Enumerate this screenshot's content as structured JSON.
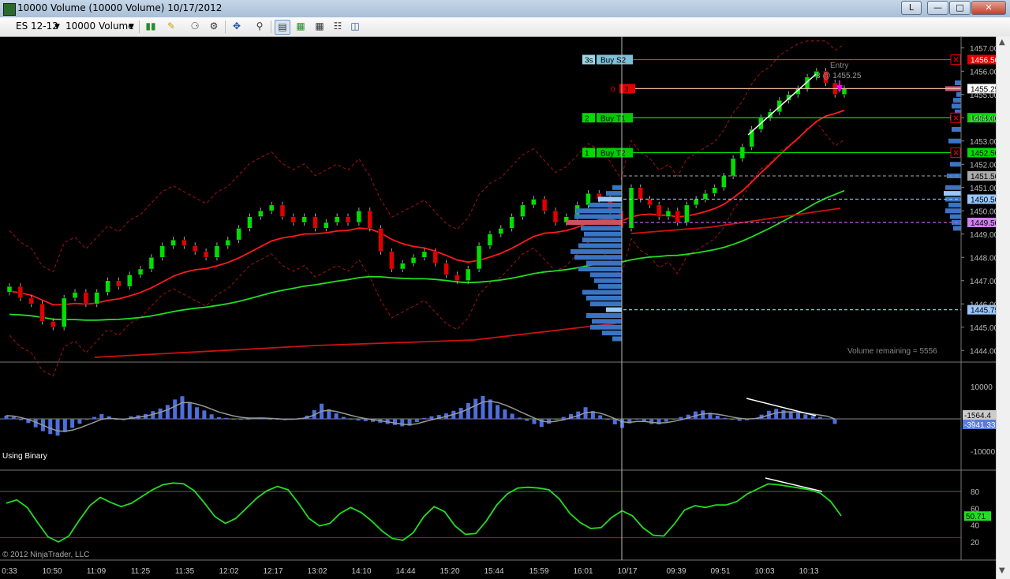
{
  "window": {
    "title": "10000 Volume (10000 Volume)  10/17/2012",
    "language_indicator": "L",
    "controls": [
      "minimize-icon",
      "restore-icon",
      "close-icon"
    ]
  },
  "toolbar": {
    "instrument": "ES 12-12",
    "period": "10000 Volume",
    "icons": [
      "bar-type-icon",
      "draw-pencil-icon",
      "indicator-icon",
      "strategy-icon",
      "crosshair-icon",
      "zoom-icon",
      "chart-trader-icon",
      "data-box-icon",
      "properties-icon",
      "templates-icon"
    ]
  },
  "colors": {
    "up_candle": "#00e000",
    "down_candle": "#e00000",
    "profile_bar": "#3a75c4",
    "macd_bar": "#4d6fdc",
    "stoch_line": "#22dd22",
    "buy_target": "#00cc00",
    "stop": "#dd0000"
  },
  "chart_data": [
    {
      "type": "candlestick",
      "instrument": "ES 12-12",
      "ylim": [
        1443.5,
        1457.5
      ],
      "y_ticks": [
        1444.0,
        1445.0,
        1446.0,
        1447.0,
        1448.0,
        1449.0,
        1450.0,
        1451.0,
        1452.0,
        1453.0,
        1454.0,
        1455.0,
        1456.0,
        1457.0
      ],
      "x_labels": [
        "0:33",
        "10:50",
        "11:09",
        "11:25",
        "11:35",
        "12:02",
        "12:17",
        "13:02",
        "14:10",
        "14:44",
        "15:20",
        "15:44",
        "15:59",
        "16:01",
        "10/17",
        "09:39",
        "09:51",
        "10:03",
        "10:13"
      ],
      "price_markers": [
        {
          "label": "1456.50",
          "style": "stop"
        },
        {
          "label": "1455.25",
          "style": "entry"
        },
        {
          "label": "1454.00",
          "style": "target"
        },
        {
          "label": "1452.50",
          "style": "target"
        },
        {
          "label": "1451.50",
          "style": "level-gray"
        },
        {
          "label": "1450.50",
          "style": "level-blue"
        },
        {
          "label": "1449.50",
          "style": "level-violet"
        },
        {
          "label": "1445.75",
          "style": "level-blue"
        }
      ],
      "orders": [
        {
          "qty": "3s",
          "name": "Buy S2",
          "price": 1456.5
        },
        {
          "qty": "0",
          "name": "3",
          "price": 1455.25
        },
        {
          "qty": "2",
          "name": "Buy T1",
          "price": 1454.0
        },
        {
          "qty": "1",
          "name": "Buy T2",
          "price": 1452.5
        }
      ],
      "annotations": {
        "entry": "Entry",
        "fill": "3 @ 1455.25",
        "volume_remaining": "Volume remaining = 5556",
        "copyright": "© 2012 NinjaTrader, LLC"
      },
      "close": [
        1446.75,
        1446.25,
        1446.0,
        1445.25,
        1445.0,
        1446.25,
        1446.5,
        1446.0,
        1446.5,
        1447.0,
        1446.75,
        1447.25,
        1447.5,
        1448.0,
        1448.5,
        1448.75,
        1448.5,
        1448.25,
        1448.0,
        1448.5,
        1448.75,
        1449.25,
        1449.75,
        1450.0,
        1450.25,
        1449.75,
        1449.5,
        1449.75,
        1449.25,
        1449.5,
        1449.75,
        1449.5,
        1450.0,
        1449.25,
        1448.25,
        1447.5,
        1447.75,
        1448.0,
        1448.25,
        1447.75,
        1447.25,
        1447.0,
        1447.5,
        1448.5,
        1449.0,
        1449.25,
        1449.75,
        1450.25,
        1450.5,
        1450.0,
        1449.5,
        1449.75,
        1450.25,
        1450.75,
        1450.5,
        1450.0,
        1449.25,
        1451.0,
        1450.5,
        1450.25,
        1449.75,
        1450.0,
        1449.5,
        1450.25,
        1450.5,
        1450.75,
        1451.0,
        1451.5,
        1452.25,
        1452.75,
        1453.5,
        1454.0,
        1454.25,
        1454.75,
        1455.0,
        1455.25,
        1455.75,
        1456.0,
        1455.5,
        1455.0,
        1455.25
      ],
      "overlays": [
        "EMA fast (red)",
        "SMA slow (green)",
        "SMA long (red)",
        "Envelope bands (dark red dashed)"
      ]
    },
    {
      "type": "bar",
      "panel": "MACD histogram",
      "label": "Using Binary",
      "y_ticks": [
        10000,
        0,
        -10000
      ],
      "value_labels": [
        "-1564.4",
        "-3941.33"
      ],
      "values": [
        1000,
        600,
        -400,
        -1300,
        -2600,
        -3800,
        -4700,
        -5200,
        -4100,
        -2800,
        -1500,
        -300,
        600,
        1500,
        800,
        -300,
        -400,
        800,
        1100,
        1500,
        2400,
        3200,
        4300,
        6000,
        7000,
        5200,
        3600,
        2600,
        1400,
        500,
        300,
        -200,
        -300,
        -100,
        200,
        300,
        -100,
        -200,
        -400,
        -100,
        300,
        1000,
        2700,
        4700,
        3000,
        1700,
        600,
        0,
        -500,
        -700,
        -900,
        -1200,
        -1600,
        -1900,
        -2300,
        -2100,
        -1000,
        300,
        800,
        1200,
        1700,
        2500,
        3400,
        4900,
        6200,
        7100,
        6000,
        4300,
        2900,
        1600,
        400,
        -600,
        -1600,
        -2500,
        -1500,
        -300,
        600,
        1500,
        2300,
        3600,
        2400,
        1100,
        -300,
        -1700,
        -2800,
        -1400,
        -200,
        -800,
        -1600,
        -1700,
        -900,
        -100,
        600,
        1300,
        2300,
        2600,
        1900,
        1000,
        300,
        -300,
        -600,
        -400,
        200,
        1300,
        2500,
        3100,
        2700,
        2200,
        1800,
        1400,
        900,
        600,
        100,
        -1564
      ]
    },
    {
      "type": "line",
      "panel": "Stochastic",
      "y_ticks": [
        80,
        60,
        40,
        20
      ],
      "value_labels": [
        "50.71"
      ],
      "values": [
        66,
        70,
        61,
        43,
        26,
        20,
        27,
        46,
        63,
        73,
        67,
        62,
        66,
        74,
        82,
        88,
        90,
        89,
        81,
        66,
        50,
        42,
        48,
        60,
        72,
        81,
        86,
        82,
        66,
        48,
        39,
        42,
        54,
        61,
        55,
        45,
        33,
        24,
        22,
        31,
        50,
        62,
        56,
        39,
        29,
        30,
        45,
        64,
        77,
        84,
        85,
        84,
        82,
        71,
        54,
        43,
        36,
        37,
        49,
        57,
        51,
        37,
        28,
        27,
        41,
        58,
        63,
        61,
        64,
        64,
        68,
        77,
        83,
        89,
        88,
        86,
        84,
        82,
        78,
        68,
        51
      ]
    }
  ]
}
